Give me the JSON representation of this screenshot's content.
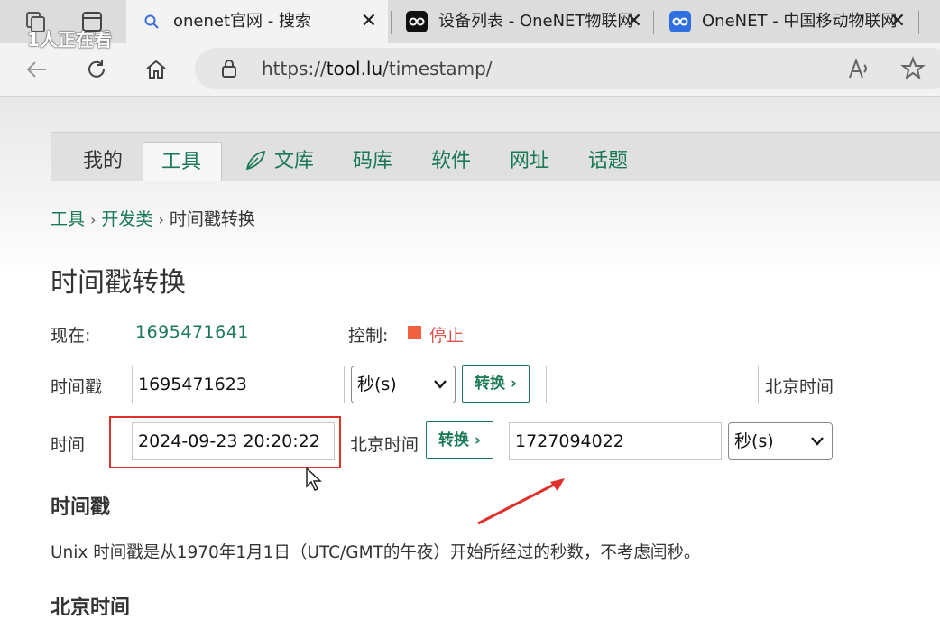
{
  "browser": {
    "watermark": "1人正在看",
    "tabs": [
      {
        "title": "onenet官网 - 搜索",
        "icon": "search-icon"
      },
      {
        "title": "设备列表 - OneNET物联网",
        "icon": "onenet-logo-icon"
      },
      {
        "title": "OneNET - 中国移动物联网",
        "icon": "onenet-logo-icon"
      }
    ],
    "close_glyph": "✕",
    "url_prefix": "https://",
    "url_domain": "tool.lu",
    "url_path": "/timestamp/"
  },
  "nav": {
    "items": [
      "我的",
      "工具",
      "文库",
      "码库",
      "软件",
      "网址",
      "话题"
    ],
    "active": "工具"
  },
  "breadcrumb": {
    "items": [
      "工具",
      "开发类",
      "时间戳转换"
    ],
    "sep": "›"
  },
  "page": {
    "title": "时间戳转换",
    "now_label": "现在:",
    "now_value": "1695471641",
    "control_label": "控制:",
    "control_value": "停止",
    "row1": {
      "label": "时间戳",
      "input_value": "1695471623",
      "unit": "秒(s)",
      "button": "转换 ›",
      "output_value": "",
      "zone": "北京时间"
    },
    "row2": {
      "label": "时间",
      "input_value": "2024-09-23 20:20:22",
      "zone": "北京时间",
      "button": "转换 ›",
      "output_value": "1727094022",
      "unit": "秒(s)"
    },
    "section_title": "时间戳",
    "section_text": "Unix 时间戳是从1970年1月1日（UTC/GMT的午夜）开始所经过的秒数，不考虑闰秒。",
    "section2_title": "北京时间"
  },
  "colors": {
    "accent": "#1a7a55",
    "stop": "#f2613f",
    "annotation": "#e0302c"
  }
}
